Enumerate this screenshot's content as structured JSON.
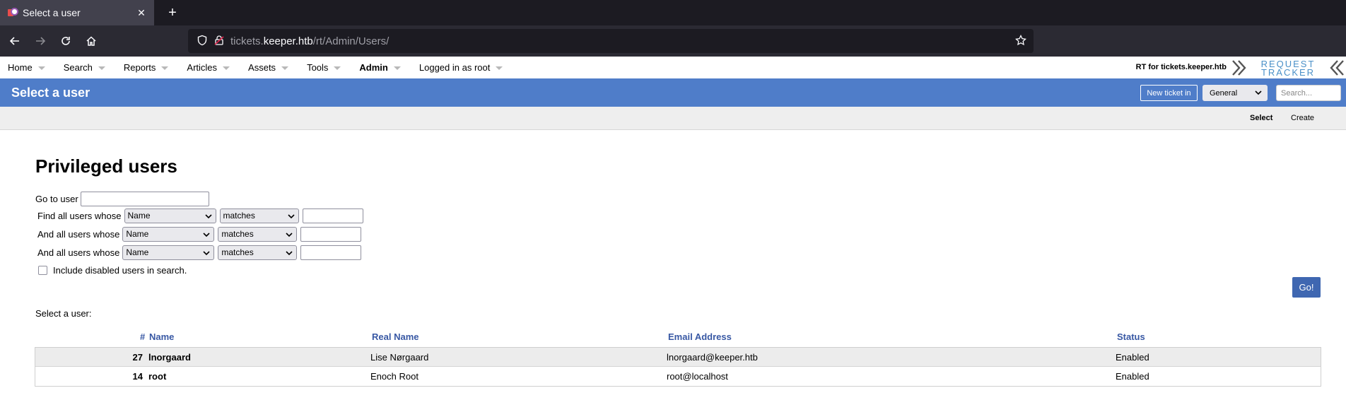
{
  "browser": {
    "tab_title": "Select a user",
    "tab_close": "✕",
    "new_tab": "+",
    "url_host_prefix": "tickets.",
    "url_host_main": "keeper.htb",
    "url_path": "/rt/Admin/Users/"
  },
  "rt": {
    "menu": [
      {
        "label": "Home"
      },
      {
        "label": "Search"
      },
      {
        "label": "Reports"
      },
      {
        "label": "Articles"
      },
      {
        "label": "Assets"
      },
      {
        "label": "Tools"
      },
      {
        "label": "Admin"
      },
      {
        "label": "Logged in as root"
      }
    ],
    "instance_label": "RT for tickets.keeper.htb",
    "logo_top": "REQUEST",
    "logo_bottom": "TRACKER",
    "page_title": "Select a user",
    "new_ticket_label": "New ticket in",
    "queue_selected": "General",
    "search_placeholder": "Search...",
    "subtabs": {
      "select": "Select",
      "create": "Create"
    }
  },
  "main": {
    "heading": "Privileged users",
    "goto_label": "Go to user",
    "find_label": "Find all users whose",
    "and_label": "And all users whose",
    "field_selected": "Name",
    "op_selected": "matches",
    "include_disabled_label": "Include disabled users in search.",
    "go_button": "Go!",
    "select_label": "Select a user:"
  },
  "table": {
    "columns": {
      "id": "#",
      "name": "Name",
      "real": "Real Name",
      "email": "Email Address",
      "status": "Status"
    },
    "rows": [
      {
        "id": "27",
        "name": "lnorgaard",
        "real": "Lise Nørgaard",
        "email": "lnorgaard@keeper.htb",
        "status": "Enabled"
      },
      {
        "id": "14",
        "name": "root",
        "real": "Enoch Root",
        "email": "root@localhost",
        "status": "Enabled"
      }
    ]
  },
  "colors": {
    "header_blue": "#4f7dc9",
    "link_blue": "#3858a4",
    "go_button": "#3f67b1"
  }
}
